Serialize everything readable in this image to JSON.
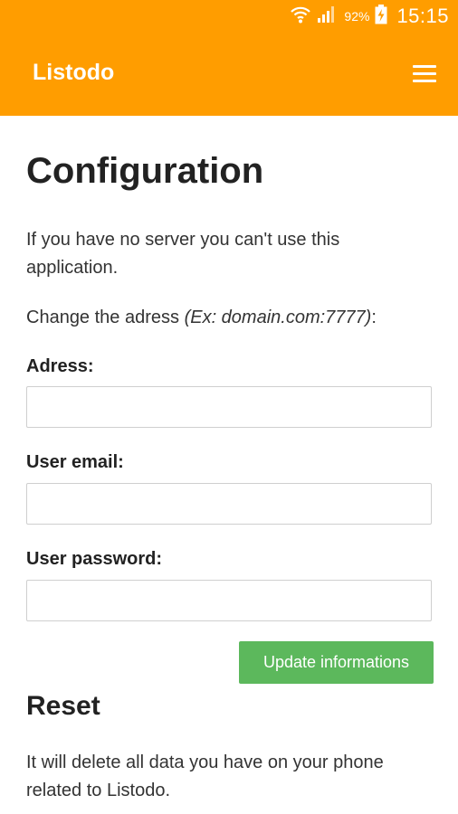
{
  "status_bar": {
    "battery_percent": "92%",
    "time": "15:15",
    "icons": [
      "wifi-icon",
      "signal-icon",
      "battery-charging-icon"
    ]
  },
  "app_bar": {
    "title": "Listodo",
    "menu_icon": "hamburger-menu-icon"
  },
  "colors": {
    "brand": "#ff9d00",
    "button": "#5cb85c"
  },
  "configuration": {
    "title": "Configuration",
    "intro": "If you have no server you can't use this application.",
    "change_prefix": "Change the adress ",
    "change_example": "(Ex: domain.com:7777)",
    "change_suffix": ":",
    "fields": [
      {
        "label": "Adress:",
        "value": "",
        "placeholder": ""
      },
      {
        "label": "User email:",
        "value": "",
        "placeholder": ""
      },
      {
        "label": "User password:",
        "value": "",
        "placeholder": ""
      }
    ],
    "update_button": "Update informations"
  },
  "reset": {
    "title": "Reset",
    "text": "It will delete all data you have on your phone related to Listodo."
  }
}
